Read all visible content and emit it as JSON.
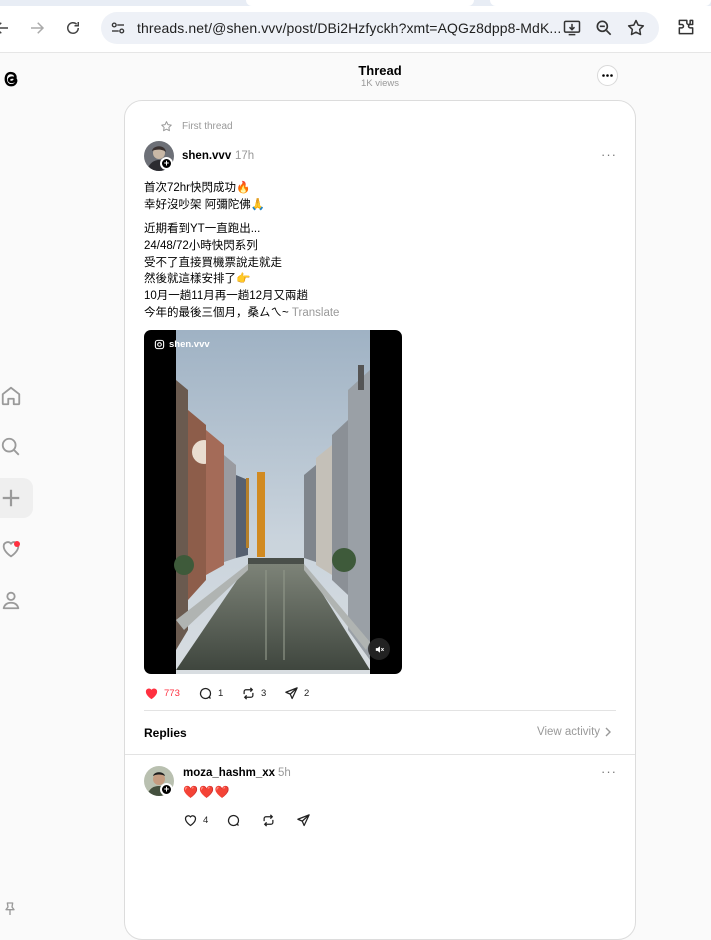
{
  "browser": {
    "url": "threads.net/@shen.vvv/post/DBi2Hzfyckh?xmt=AQGz8dpp8-MdK...",
    "icons": [
      "back-arrow-icon",
      "forward-arrow-icon",
      "reload-icon",
      "site-settings-icon",
      "install-app-icon",
      "zoom-icon",
      "bookmark-star-icon",
      "extensions-icon"
    ]
  },
  "header": {
    "title": "Thread",
    "views": "1K views"
  },
  "post": {
    "context_label": "First thread",
    "username": "shen.vvv",
    "time": "17h",
    "text_block1": "首次72hr快閃成功🔥\n幸好沒吵架 阿彌陀佛🙏",
    "text_block2": "近期看到YT一直跑出...\n24/48/72小時快閃系列\n受不了直接買機票說走就走\n然後就這樣安排了👉\n10月一趟11月再一趟12月又兩趟\n今年的最後三個月，桑ㄙㄟ~",
    "translate_label": "Translate",
    "media_label": "shen.vvv",
    "likes": "773",
    "comments": "1",
    "reposts": "3",
    "shares": "2"
  },
  "replies_section": {
    "label": "Replies",
    "view_activity": "View activity"
  },
  "reply": {
    "username": "moza_hashm_xx",
    "time": "5h",
    "text": "❤️❤️❤️",
    "likes": "4"
  },
  "colors": {
    "like_red": "#ff3040",
    "muted_gray": "#999999",
    "border": "#dcdcdc"
  }
}
